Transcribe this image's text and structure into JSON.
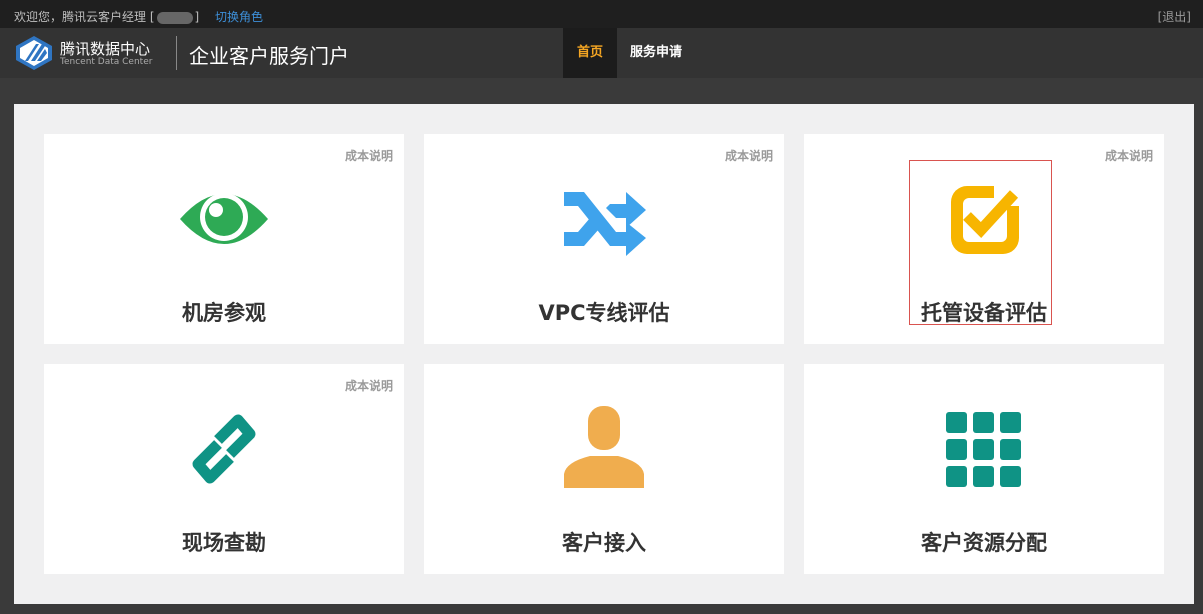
{
  "topbar": {
    "welcome": "欢迎您，腾讯云客户经理 [",
    "welcome_end": "]",
    "switch_role": "切换角色",
    "logout": "[退出]"
  },
  "header": {
    "brand_cn": "腾讯数据中心",
    "brand_en": "Tencent Data Center",
    "portal_title": "企业客户服务门户",
    "nav": {
      "home": "首页",
      "service": "服务申请"
    }
  },
  "cards": [
    {
      "label": "机房参观",
      "cost": "成本说明",
      "icon": "eye-icon",
      "color": "#2eaa55"
    },
    {
      "label": "VPC专线评估",
      "cost": "成本说明",
      "icon": "shuffle-icon",
      "color": "#3fa3ec"
    },
    {
      "label": "托管设备评估",
      "cost": "成本说明",
      "icon": "check-icon",
      "color": "#f7b500"
    },
    {
      "label": "现场查勘",
      "cost": "成本说明",
      "icon": "link-icon",
      "color": "#0f9385"
    },
    {
      "label": "客户接入",
      "icon": "user-icon",
      "color": "#f0ad4e"
    },
    {
      "label": "客户资源分配",
      "icon": "grid-icon",
      "color": "#0f9385"
    }
  ]
}
